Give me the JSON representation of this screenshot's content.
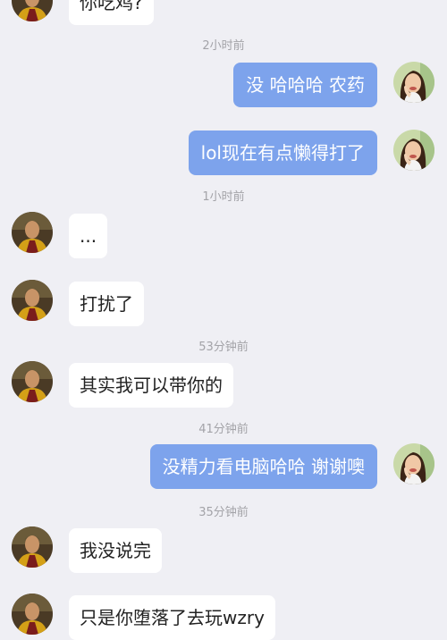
{
  "timestamps": {
    "t1": "2小时前",
    "t2": "1小时前",
    "t3": "53分钟前",
    "t4": "41分钟前",
    "t5": "35分钟前"
  },
  "messages": [
    {
      "side": "incoming",
      "text": "你吃鸡?"
    },
    {
      "side": "outgoing",
      "text": "没 哈哈哈 农药"
    },
    {
      "side": "outgoing",
      "text": "lol现在有点懒得打了"
    },
    {
      "side": "incoming",
      "text": "..."
    },
    {
      "side": "incoming",
      "text": "打扰了"
    },
    {
      "side": "incoming",
      "text": "其实我可以带你的"
    },
    {
      "side": "outgoing",
      "text": "没精力看电脑哈哈 谢谢噢"
    },
    {
      "side": "incoming",
      "text": "我没说完"
    },
    {
      "side": "incoming",
      "text": "只是你堕落了去玩wzry"
    }
  ],
  "colors": {
    "background": "#efeff4",
    "outgoing_bubble": "#7da3ec",
    "incoming_bubble": "#ffffff",
    "timestamp": "#a3a3a8"
  },
  "icons": {
    "contact_avatar": "man-portrait-avatar",
    "self_avatar": "woman-portrait-avatar"
  }
}
